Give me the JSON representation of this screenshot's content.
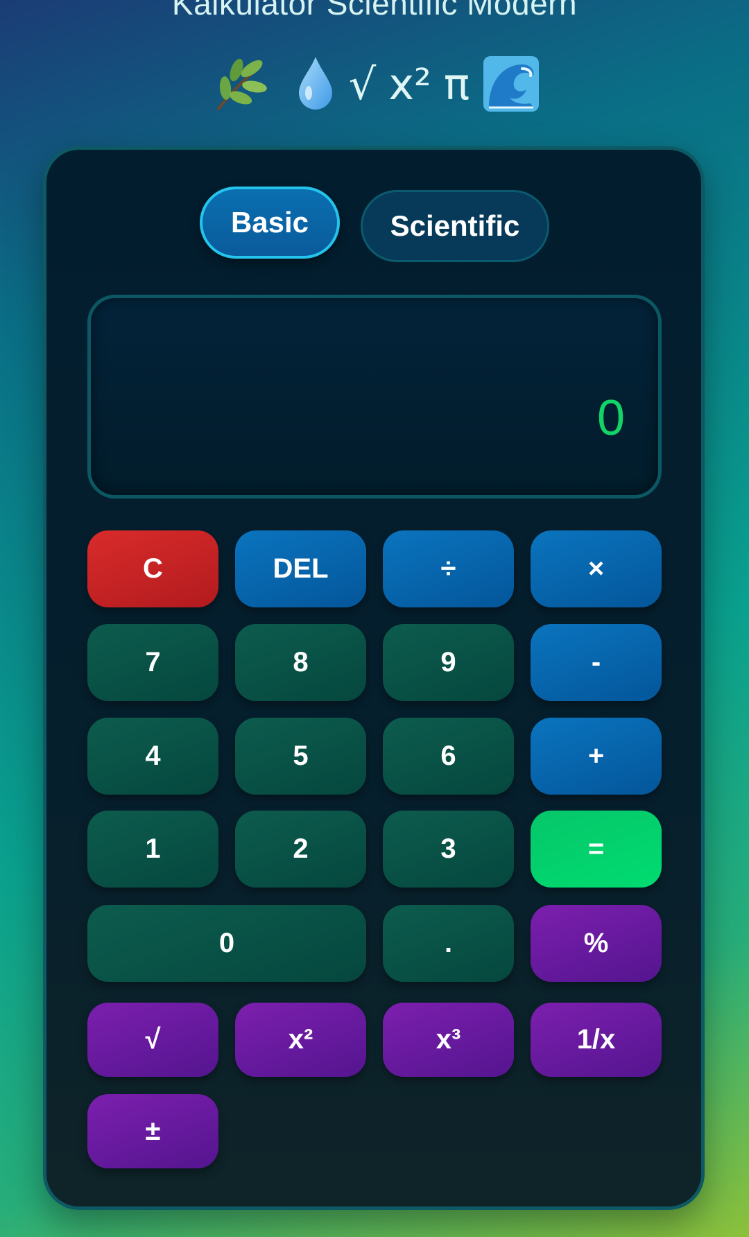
{
  "app": {
    "title": "Kalkulator Scientific Modern"
  },
  "header": {
    "icons": [
      "leaf-emoji-icon",
      "droplet-emoji-icon",
      "wave-emoji-icon"
    ],
    "symbols": [
      "√",
      "x²",
      "π"
    ]
  },
  "tabs": {
    "basic": "Basic",
    "scientific": "Scientific",
    "active": "Basic"
  },
  "display": {
    "value": "0",
    "color": "#13d466"
  },
  "keys": {
    "clear": "C",
    "delete": "DEL",
    "divide": "÷",
    "multiply": "×",
    "seven": "7",
    "eight": "8",
    "nine": "9",
    "minus": "-",
    "four": "4",
    "five": "5",
    "six": "6",
    "plus": "+",
    "one": "1",
    "two": "2",
    "three": "3",
    "equals": "=",
    "zero": "0",
    "decimal": ".",
    "percent": "%",
    "sqrt": "√",
    "square": "x²",
    "cube": "x³",
    "reciprocal": "1/x",
    "negate": "±"
  },
  "colors": {
    "number_key": "#05473e",
    "operator_key": "#04569a",
    "clear_key": "#d92b2b",
    "equals_key": "#00dc70",
    "function_key": "#6a1aa0",
    "active_tab_border": "#24c4ec"
  }
}
